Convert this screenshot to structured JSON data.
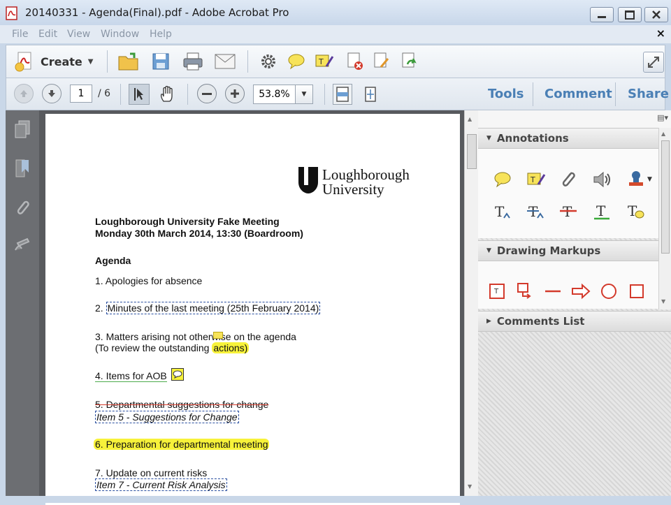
{
  "window": {
    "title": "20140331 - Agenda(Final).pdf - Adobe Acrobat Pro",
    "close_x": "×"
  },
  "menu": [
    "File",
    "Edit",
    "View",
    "Window",
    "Help"
  ],
  "toolbar": {
    "create_label": "Create",
    "icons": [
      "open-folder-icon",
      "save-icon",
      "print-icon",
      "email-icon",
      "settings-icon",
      "comment-icon",
      "sign-icon",
      "delete-icon",
      "edit-icon",
      "export-icon"
    ]
  },
  "nav": {
    "page_current": "1",
    "page_total": "/ 6",
    "zoom_value": "53.8%"
  },
  "panes": {
    "tools": "Tools",
    "comment": "Comment",
    "share": "Share"
  },
  "document": {
    "logo_line1": "Loughborough",
    "logo_line2": "University",
    "meeting_title": "Loughborough University Fake Meeting",
    "meeting_date": "Monday 30th March 2014, 13:30 (Boardroom)",
    "agenda_heading": "Agenda",
    "item1": "1. Apologies for absence",
    "item2_prefix": "2. ",
    "item2_text": "Minutes of the last meeting (25th February 2014)",
    "item3_line1": "3. Matters arising not otherwise on the agenda",
    "item3_line2_prefix": "(To review the outstanding ",
    "item3_line2_highlight": "actions)",
    "item4": "4. Items for AOB",
    "item5": "5. Departmental suggestions for change",
    "item5_note": "Item 5 - Suggestions for Change",
    "item6": "6. Preparation for departmental meeting",
    "item7": "7. Update on current risks",
    "item7_note": "Item 7 - Current Risk Analysis"
  },
  "right_panel": {
    "annotations_header": "Annotations",
    "drawing_header": "Drawing Markups",
    "comments_list_header": "Comments List"
  },
  "colors": {
    "pane_link": "#4a7fb5",
    "highlight": "#f7f23a",
    "markup_red": "#d33a2c"
  }
}
